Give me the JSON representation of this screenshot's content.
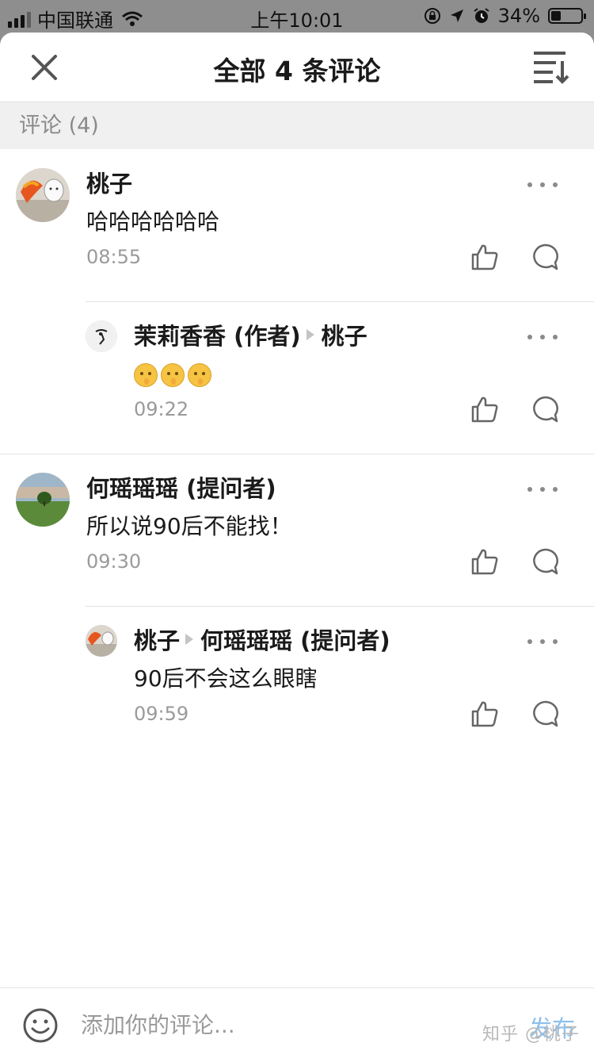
{
  "status_bar": {
    "carrier": "中国联通",
    "time": "上午10:01",
    "battery": "34%",
    "battery_level": 0.34
  },
  "header": {
    "title": "全部 4 条评论",
    "close_icon": "close-icon",
    "sort_icon": "sort-icon"
  },
  "section_label": "评论 (4)",
  "comments": [
    {
      "author": "桃子",
      "text": "哈哈哈哈哈哈",
      "time": "08:55"
    },
    {
      "author": "茉莉香香 (作者)",
      "reply_to": "桃子",
      "emojis": [
        "shushing-face",
        "shushing-face",
        "shushing-face"
      ],
      "time": "09:22"
    },
    {
      "author": "何瑶瑶瑶 (提问者)",
      "text": "所以说90后不能找！",
      "time": "09:30"
    },
    {
      "author": "桃子",
      "reply_to": "何瑶瑶瑶 (提问者)",
      "text": "90后不会这么眼瞎",
      "time": "09:59"
    }
  ],
  "input_bar": {
    "placeholder": "添加你的评论...",
    "publish_label": "发布",
    "watermark": "知乎 @桃子"
  },
  "colors": {
    "accent": "#8bbfee",
    "secondary_text": "#9a9a9a",
    "section_bg": "#f0f0f0"
  }
}
